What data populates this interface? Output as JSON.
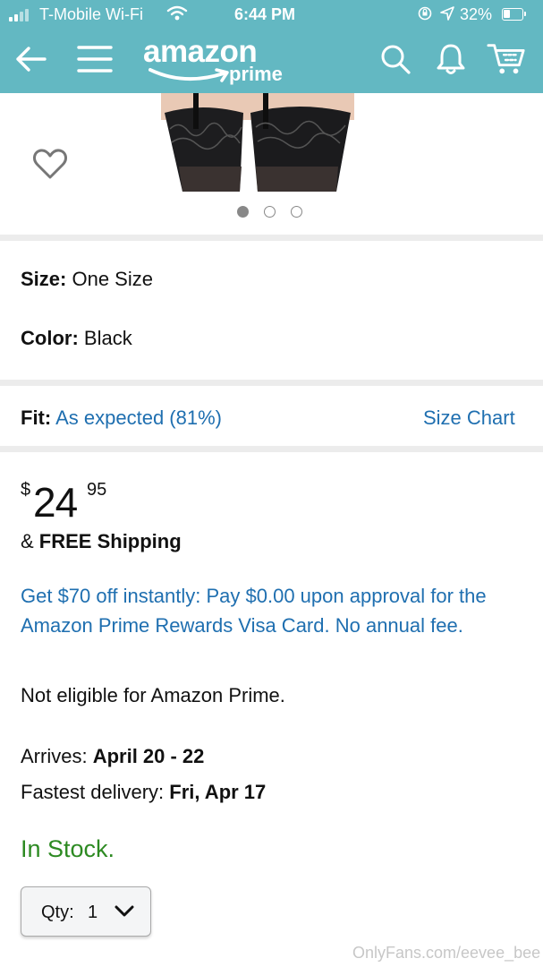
{
  "status_bar": {
    "carrier": "T-Mobile Wi-Fi",
    "time": "6:44 PM",
    "battery_percent": "32%",
    "icons": [
      "signal-icon",
      "wifi-icon",
      "rotation-lock-icon",
      "location-icon",
      "battery-icon"
    ]
  },
  "nav": {
    "logo_word": "amazon",
    "logo_sub": "prime",
    "icons": [
      "back-arrow-icon",
      "hamburger-menu-icon",
      "search-icon",
      "bell-icon",
      "cart-icon"
    ]
  },
  "product": {
    "image_dots": 3,
    "active_dot": 0,
    "wishlist_icon": "heart-icon"
  },
  "variations": {
    "size_label": "Size:",
    "size_value": "One Size",
    "color_label": "Color:",
    "color_value": "Black"
  },
  "fit": {
    "label": "Fit:",
    "value": "As expected (81%)",
    "size_chart_link": "Size Chart"
  },
  "price": {
    "currency": "$",
    "whole": "24",
    "fraction": "95"
  },
  "shipping": {
    "prefix": "& ",
    "text": "FREE Shipping"
  },
  "promo": "Get $70 off instantly: Pay $0.00 upon approval for the Amazon Prime Rewards Visa Card. No annual fee.",
  "prime_eligibility": "Not eligible for Amazon Prime.",
  "delivery": {
    "arrives_label": "Arrives: ",
    "arrives_value": "April 20 - 22",
    "fastest_label": "Fastest delivery: ",
    "fastest_value": "Fri, Apr 17"
  },
  "stock_status": "In Stock.",
  "quantity": {
    "label": "Qty:",
    "value": "1"
  },
  "watermark": "OnlyFans.com/eevee_bee",
  "colors": {
    "header": "#63b8c2",
    "link": "#1f6fb0",
    "in_stock": "#2d8a22"
  }
}
